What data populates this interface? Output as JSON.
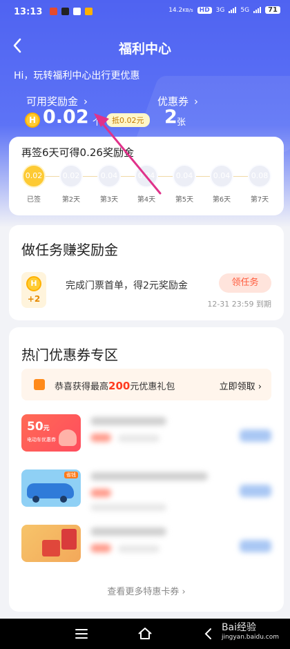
{
  "status_bar": {
    "time": "13:13",
    "network_speed": "14.2",
    "network_unit": "KB/s",
    "hd_badge": "HD",
    "signal_1": "3G",
    "signal_2": "5G",
    "battery": "71"
  },
  "header": {
    "title": "福利中心",
    "subtitle": "Hi，玩转福利中心出行更优惠"
  },
  "balance": {
    "reward_label": "可用奖励金",
    "reward_value": "0.02",
    "reward_unit": "个",
    "deduct_text": "抵0.02元",
    "coupon_label": "优惠券",
    "coupon_value": "2",
    "coupon_unit": "张",
    "chevron": "›"
  },
  "signin": {
    "title": "再签6天可得0.26奖励金",
    "days": [
      {
        "value": "0.02",
        "label": "已签",
        "done": true
      },
      {
        "value": "0.02",
        "label": "第2天",
        "done": false
      },
      {
        "value": "0.04",
        "label": "第3天",
        "done": false
      },
      {
        "value": "0.04",
        "label": "第4天",
        "done": false
      },
      {
        "value": "0.04",
        "label": "第5天",
        "done": false
      },
      {
        "value": "0.04",
        "label": "第6天",
        "done": false
      },
      {
        "value": "0.08",
        "label": "第7天",
        "done": false
      }
    ]
  },
  "tasks": {
    "title": "做任务赚奖励金",
    "items": [
      {
        "icon_letter": "H",
        "bonus": "+2",
        "text": "完成门票首单，得2元奖励金",
        "button": "领任务",
        "deadline": "12-31 23:59 到期"
      }
    ]
  },
  "coupons": {
    "title": "热门优惠券专区",
    "promo_prefix": "恭喜获得最高",
    "promo_amount": "200",
    "promo_suffix": "元优惠礼包",
    "promo_claim": "立即领取",
    "items": [
      {
        "thumb_amount": "50",
        "thumb_unit": "元",
        "thumb_caption": "电动车优惠券",
        "thumb_color": "#ff5a4a"
      },
      {
        "thumb_tag": "省钱",
        "thumb_color": "#8fd0f5"
      },
      {
        "thumb_color": "#f6c46a"
      }
    ],
    "more": "查看更多特惠卡券"
  },
  "watermark": {
    "brand": "Bai经验",
    "url": "jingyan.baidu.com"
  },
  "colors": {
    "primary": "#4f63f1",
    "gold": "#fdca34",
    "accent": "#ff5a3c"
  }
}
